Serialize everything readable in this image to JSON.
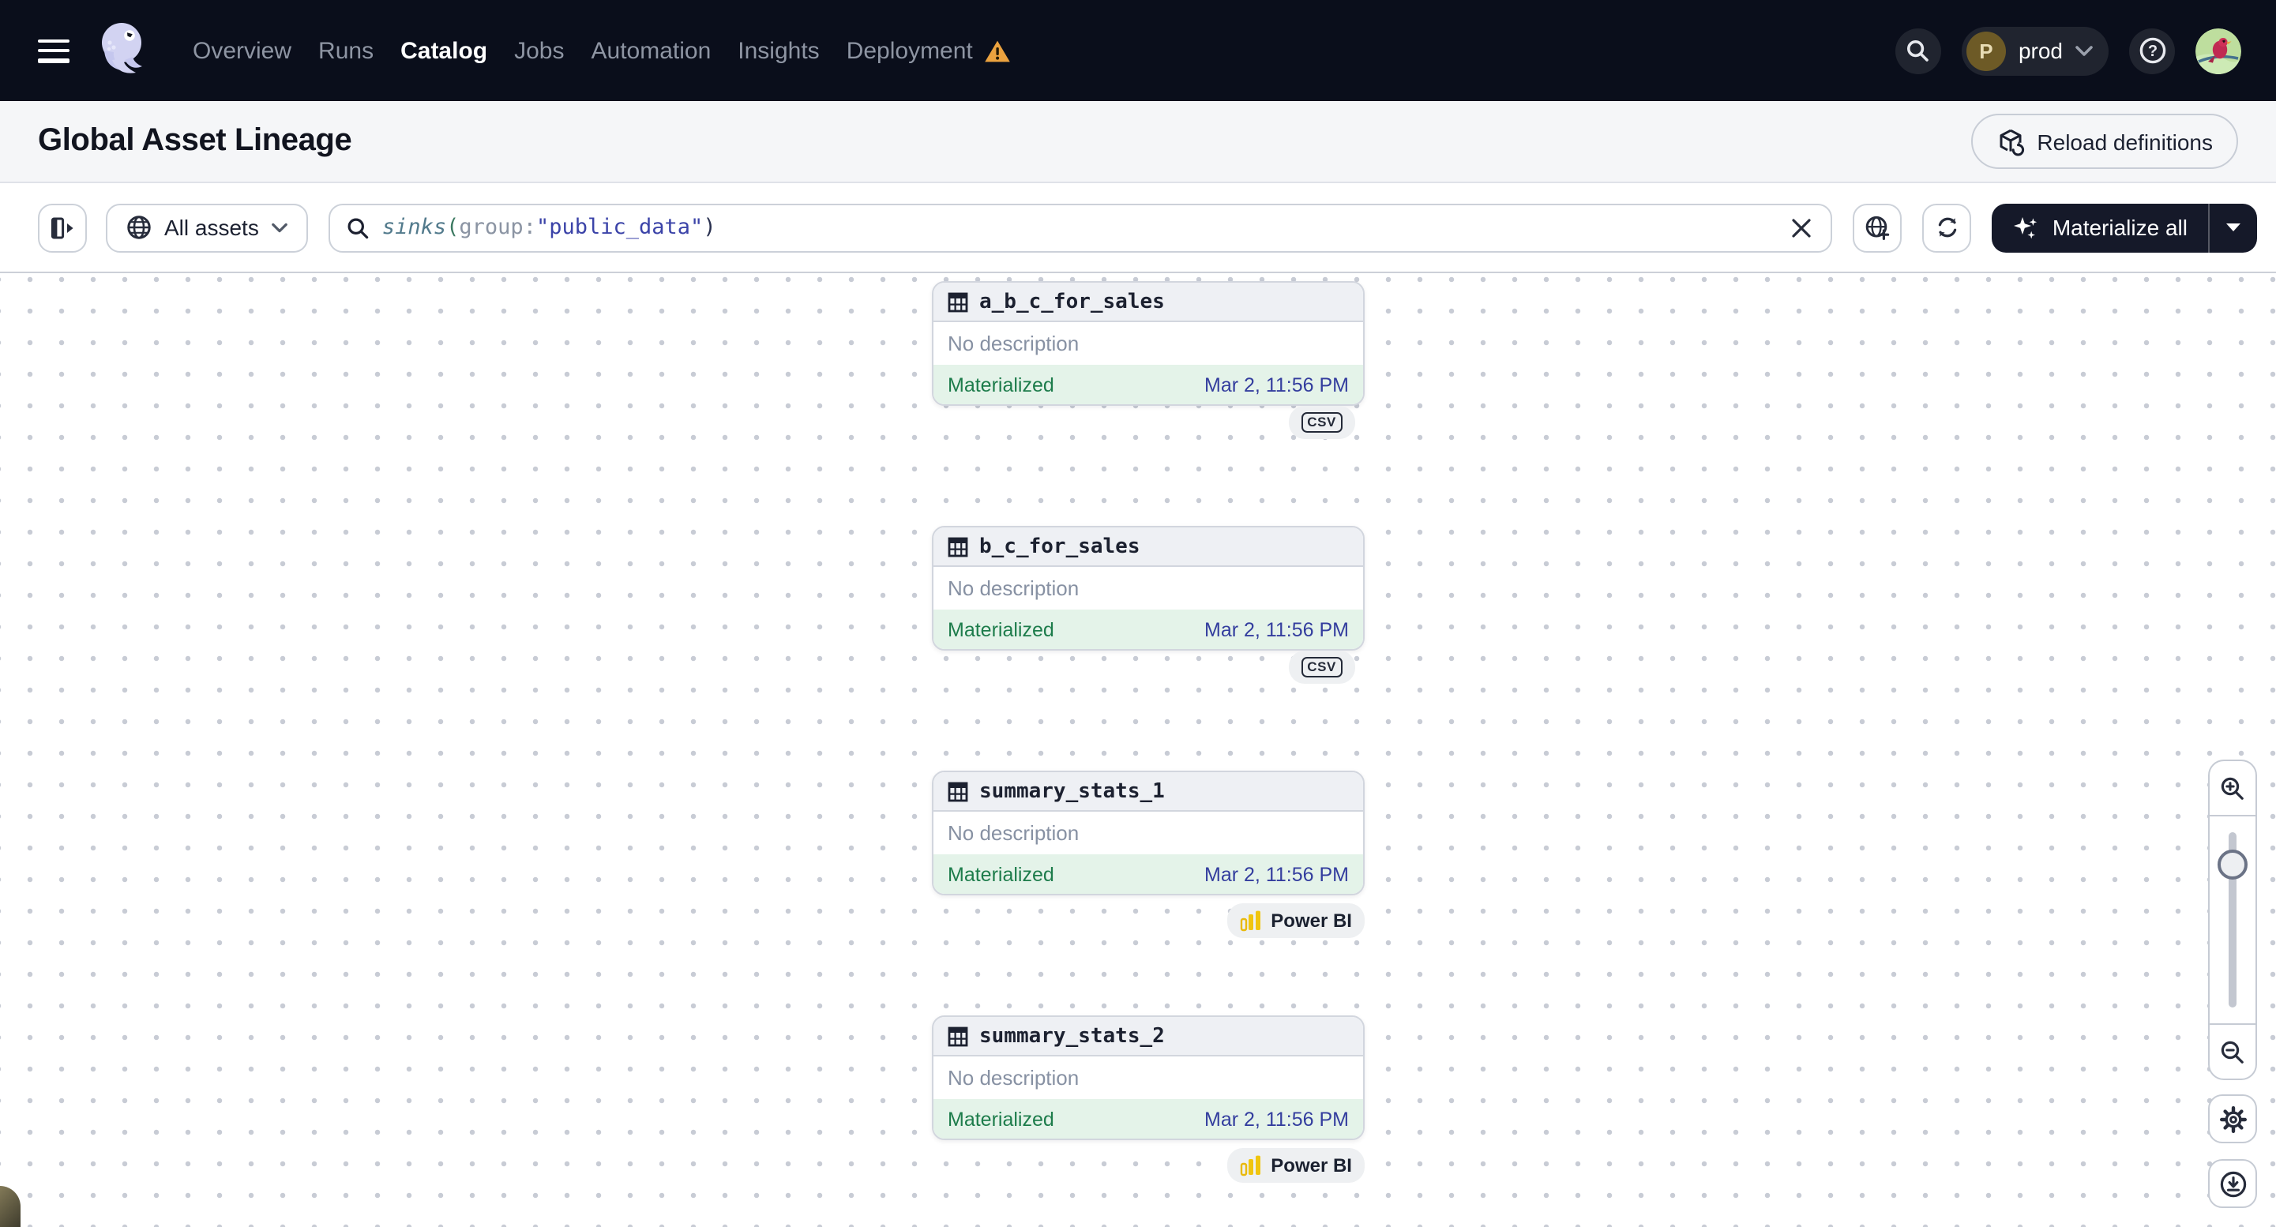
{
  "nav": {
    "menu_icon": "hamburger-icon",
    "logo_icon": "dagster-octopus-logo",
    "items": [
      {
        "label": "Overview",
        "active": false
      },
      {
        "label": "Runs",
        "active": false
      },
      {
        "label": "Catalog",
        "active": true
      },
      {
        "label": "Jobs",
        "active": false
      },
      {
        "label": "Automation",
        "active": false
      },
      {
        "label": "Insights",
        "active": false
      },
      {
        "label": "Deployment",
        "active": false,
        "warning_icon": "warning-triangle-icon"
      }
    ],
    "search_icon": "search-icon",
    "environment": {
      "initial": "P",
      "name": "prod",
      "caret_icon": "chevron-down-icon"
    },
    "help_icon": "help-icon",
    "avatar_icon": "user-avatar-cardinal"
  },
  "header": {
    "title": "Global Asset Lineage",
    "reload_button": {
      "icon": "reload-definitions-icon",
      "label": "Reload definitions"
    }
  },
  "toolbar": {
    "panel_toggle_icon": "open-panel-icon",
    "scope": {
      "icon": "globe-icon",
      "label": "All assets",
      "caret_icon": "chevron-down-icon"
    },
    "query": {
      "icon": "search-icon",
      "function": "sinks",
      "open_paren": "(",
      "attribute": "group",
      "colon": ":",
      "value": "\"public_data\"",
      "close_paren": ")",
      "clear_icon": "close-icon"
    },
    "filter_button_icon": "globe-plus-icon",
    "refresh_button_icon": "refresh-icon",
    "materialize": {
      "icon": "sparkle-icon",
      "label": "Materialize all",
      "caret_icon": "caret-down-icon"
    }
  },
  "canvas": {
    "nodes": [
      {
        "icon": "table-icon",
        "name": "a_b_c_for_sales",
        "description": "No description",
        "status": "Materialized",
        "timestamp": "Mar 2, 11:56 PM",
        "tag": {
          "kind": "csv",
          "label": "CSV"
        }
      },
      {
        "icon": "table-icon",
        "name": "b_c_for_sales",
        "description": "No description",
        "status": "Materialized",
        "timestamp": "Mar 2, 11:56 PM",
        "tag": {
          "kind": "csv",
          "label": "CSV"
        }
      },
      {
        "icon": "table-icon",
        "name": "summary_stats_1",
        "description": "No description",
        "status": "Materialized",
        "timestamp": "Mar 2, 11:56 PM",
        "tag": {
          "kind": "power-bi",
          "icon": "power-bi-icon",
          "label": "Power BI"
        }
      },
      {
        "icon": "table-icon",
        "name": "summary_stats_2",
        "description": "No description",
        "status": "Materialized",
        "timestamp": "Mar 2, 11:56 PM",
        "tag": {
          "kind": "power-bi",
          "icon": "power-bi-icon",
          "label": "Power BI"
        }
      }
    ],
    "controls": {
      "zoom_in_icon": "zoom-in-icon",
      "zoom_out_icon": "zoom-out-icon",
      "settings_icon": "gear-icon",
      "export_icon": "download-icon"
    }
  },
  "colors": {
    "nav_bg": "#0a0e1b",
    "status_materialized_green": "#1d7c4b",
    "timestamp_indigo": "#333d9e",
    "warning_amber": "#eba23f",
    "power_bi_yellow": "#f0c50f",
    "materialize_button_bg": "#151929"
  }
}
